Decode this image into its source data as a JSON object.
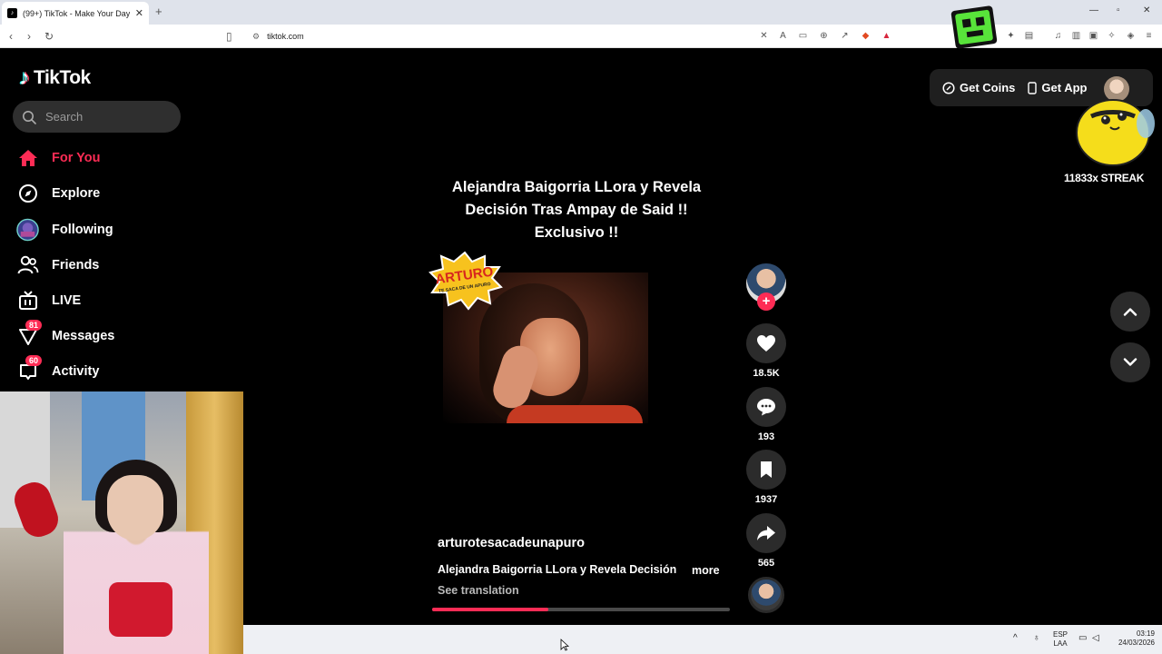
{
  "browser": {
    "tab_title": "(99+) TikTok - Make Your Day",
    "tab_close": "✕",
    "new_tab": "+",
    "url": "tiktok.com"
  },
  "sidebar": {
    "logo_text": "TikTok",
    "search_placeholder": "Search",
    "items": [
      {
        "label": "For You",
        "icon": "home-icon",
        "active": true
      },
      {
        "label": "Explore",
        "icon": "compass-icon"
      },
      {
        "label": "Following",
        "icon": "following-avatar-icon"
      },
      {
        "label": "Friends",
        "icon": "friends-icon"
      },
      {
        "label": "LIVE",
        "icon": "live-icon"
      },
      {
        "label": "Messages",
        "icon": "messages-icon",
        "badge": "81"
      },
      {
        "label": "Activity",
        "icon": "activity-icon",
        "badge": "60"
      }
    ]
  },
  "header": {
    "get_coins": "Get Coins",
    "get_app": "Get App"
  },
  "overlay": {
    "streak": "11833x STREAK"
  },
  "video": {
    "title_line1": "Alejandra Baigorria LLora y Revela",
    "title_line2": "Decisión Tras Ampay de Said !!",
    "title_line3": "Exclusivo !!",
    "author": "arturotesacadeunapuro",
    "description": "Alejandra Baigorria LLora y Revela Decisión",
    "more": "more",
    "see_translation": "See translation",
    "progress": 0.39,
    "sticker_text": "ARTURO",
    "sticker_sub": "TE SACA DE UN APURO"
  },
  "actions": {
    "likes": "18.5K",
    "comments": "193",
    "saves": "1937",
    "shares": "565"
  },
  "taskbar": {
    "lang_top": "ESP",
    "lang_bottom": "LAA",
    "time": "03:19",
    "date": "24/03/2026"
  },
  "colors": {
    "accent": "#fe2c55",
    "background": "#000000",
    "button_bg": "#2b2b2b"
  }
}
